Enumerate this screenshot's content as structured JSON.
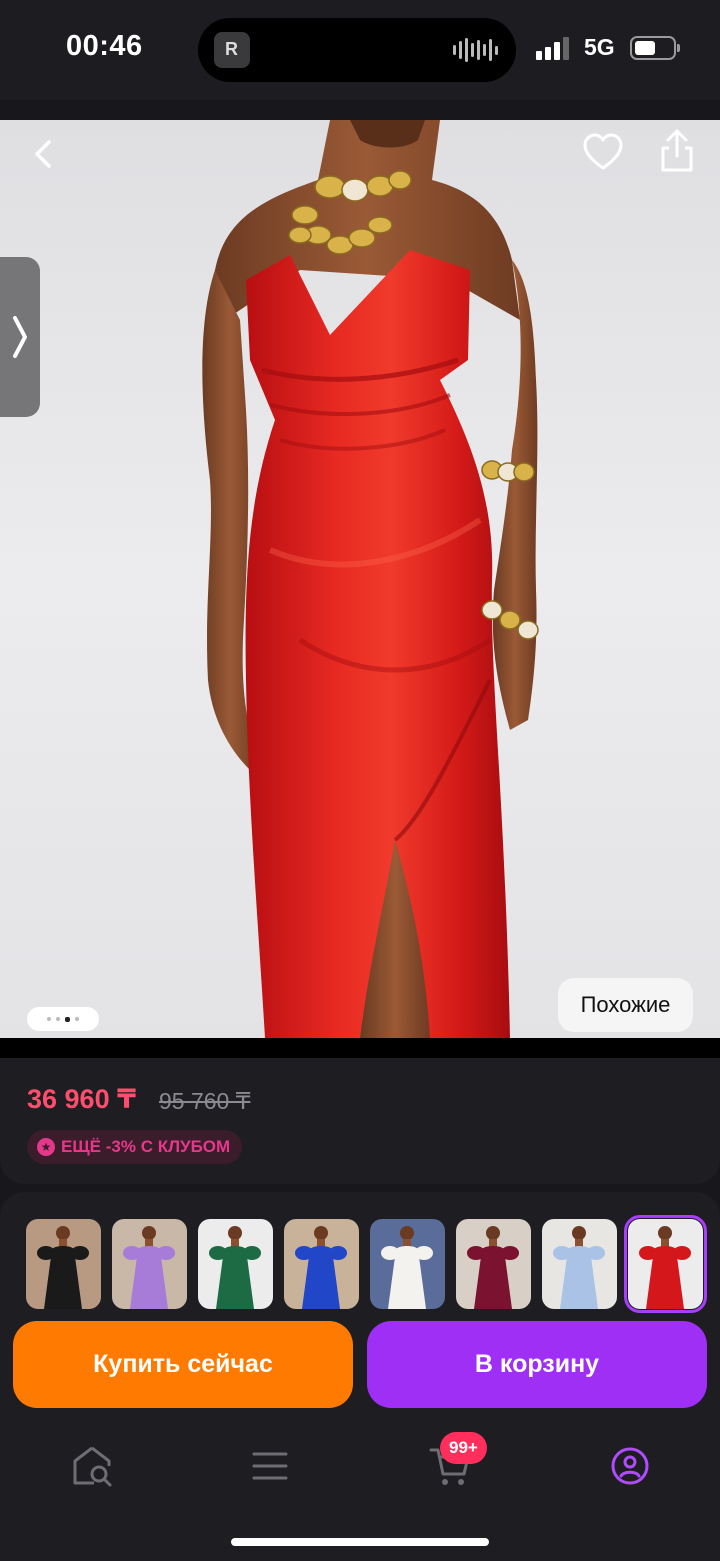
{
  "status_bar": {
    "time": "00:46",
    "network": "5G"
  },
  "product": {
    "image_alt": "Red satin strapless dress",
    "gallery_pages": 4,
    "gallery_active_index": 2,
    "similar_label": "Похожие",
    "price_current": "36 960 ₸",
    "price_old": "95 760 ₸",
    "club_badge": "ЕЩЁ -3% С КЛУБОМ"
  },
  "variants": [
    {
      "name": "black-dress",
      "dress_color": "#1a1a1a",
      "bg": "#b89a82",
      "selected": false
    },
    {
      "name": "lilac-dress",
      "dress_color": "#a77bd8",
      "bg": "#c9b7a8",
      "selected": false
    },
    {
      "name": "green-dress",
      "dress_color": "#1d6b45",
      "bg": "#ececec",
      "selected": false
    },
    {
      "name": "blue-dress",
      "dress_color": "#2246c8",
      "bg": "#c8b39a",
      "selected": false
    },
    {
      "name": "white-dress",
      "dress_color": "#f4f2ee",
      "bg": "#5a6d9a",
      "selected": false
    },
    {
      "name": "burgundy-dress",
      "dress_color": "#7a1230",
      "bg": "#d8d0c6",
      "selected": false
    },
    {
      "name": "light-blue-dress",
      "dress_color": "#a9c2e6",
      "bg": "#e8e6e3",
      "selected": false
    },
    {
      "name": "red-dress",
      "dress_color": "#d3171b",
      "bg": "#ececec",
      "selected": true
    }
  ],
  "actions": {
    "buy_now": "Купить сейчас",
    "add_to_cart": "В корзину"
  },
  "nav": {
    "cart_badge": "99+",
    "items": [
      "home-search-icon",
      "catalog-menu-icon",
      "cart-icon",
      "profile-icon"
    ]
  },
  "colors": {
    "accent_orange": "#ff7a00",
    "accent_purple": "#a02ff5",
    "price_pink": "#ff4d6d",
    "club_pink": "#e6388b"
  }
}
